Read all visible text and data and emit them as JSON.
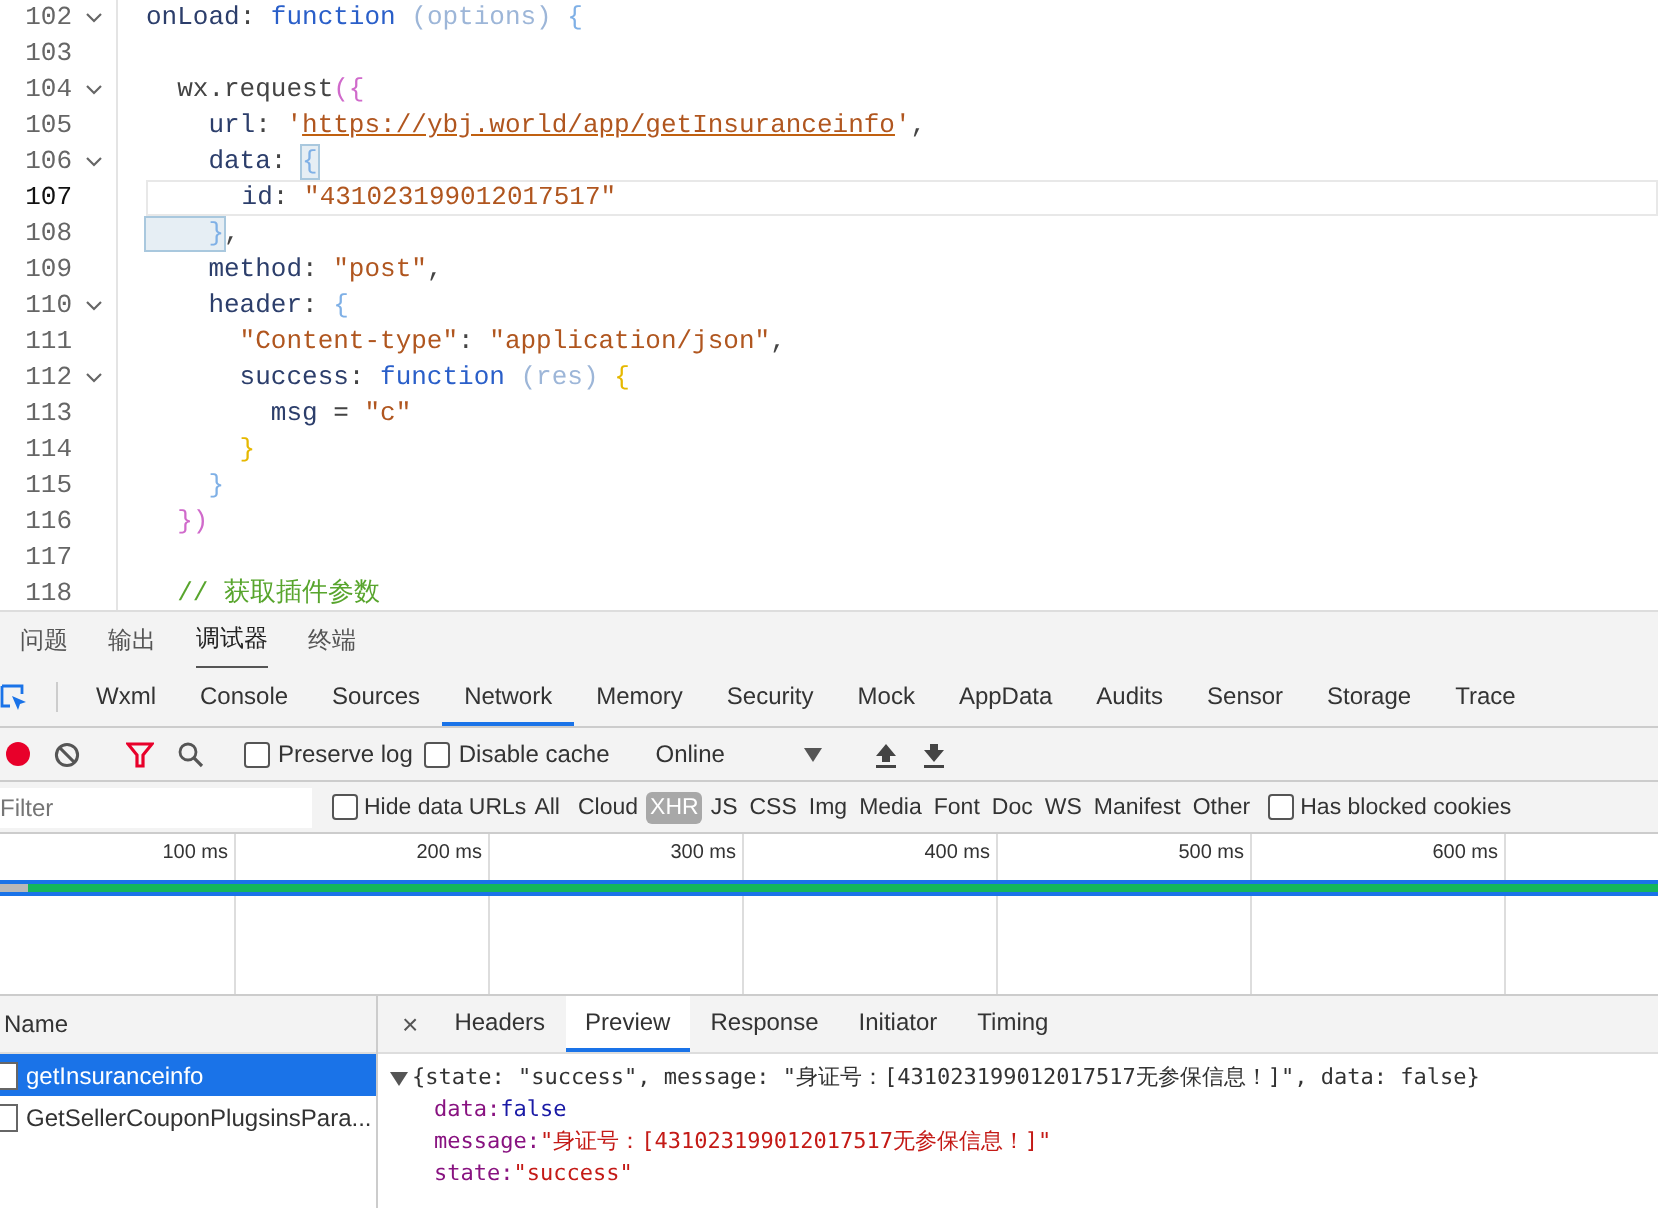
{
  "editor": {
    "lines": [
      {
        "number": "102",
        "foldable": true,
        "current": false,
        "tokens": [
          {
            "text": "onLoad",
            "kind": "key"
          },
          {
            "text": ": ",
            "kind": "plain"
          },
          {
            "text": "function ",
            "kind": "keyword"
          },
          {
            "text": "(options) ",
            "kind": "param"
          },
          {
            "text": "{",
            "kind": "brace"
          }
        ]
      },
      {
        "number": "103",
        "foldable": false,
        "current": false
      },
      {
        "number": "104",
        "foldable": true,
        "current": false,
        "tokens": [
          {
            "text": "  wx.request",
            "kind": "plain"
          },
          {
            "text": "({",
            "kind": "paren"
          }
        ]
      },
      {
        "number": "105",
        "foldable": false,
        "current": false,
        "tokens": [
          {
            "text": "    url",
            "kind": "key"
          },
          {
            "text": ": ",
            "kind": "plain"
          },
          {
            "text": "'",
            "kind": "string"
          },
          {
            "text": "https://ybj.world/app/getInsuranceinfo",
            "kind": "url"
          },
          {
            "text": "'",
            "kind": "string"
          },
          {
            "text": ",",
            "kind": "plain"
          }
        ]
      },
      {
        "number": "106",
        "foldable": true,
        "current": false,
        "tokens": [
          {
            "text": "    data",
            "kind": "key"
          },
          {
            "text": ": ",
            "kind": "plain"
          },
          {
            "text": "{",
            "kind": "match"
          }
        ]
      },
      {
        "number": "107",
        "foldable": false,
        "current": true,
        "tokens": [
          {
            "text": "      id",
            "kind": "key"
          },
          {
            "text": ": ",
            "kind": "plain"
          },
          {
            "text": "\"431023199012017517\"",
            "kind": "string"
          }
        ]
      },
      {
        "number": "108",
        "foldable": false,
        "current": false,
        "tokens": [
          {
            "text": "    }",
            "kind": "match"
          },
          {
            "text": ",",
            "kind": "plain"
          }
        ]
      },
      {
        "number": "109",
        "foldable": false,
        "current": false,
        "tokens": [
          {
            "text": "    method",
            "kind": "key"
          },
          {
            "text": ": ",
            "kind": "plain"
          },
          {
            "text": "\"post\"",
            "kind": "string"
          },
          {
            "text": ",",
            "kind": "plain"
          }
        ]
      },
      {
        "number": "110",
        "foldable": true,
        "current": false,
        "tokens": [
          {
            "text": "    header",
            "kind": "key"
          },
          {
            "text": ": ",
            "kind": "plain"
          },
          {
            "text": "{",
            "kind": "brace"
          }
        ]
      },
      {
        "number": "111",
        "foldable": false,
        "current": false,
        "tokens": [
          {
            "text": "      \"Content-type\"",
            "kind": "string"
          },
          {
            "text": ": ",
            "kind": "plain"
          },
          {
            "text": "\"application/json\"",
            "kind": "string"
          },
          {
            "text": ",",
            "kind": "plain"
          }
        ]
      },
      {
        "number": "112",
        "foldable": true,
        "current": false,
        "tokens": [
          {
            "text": "      success",
            "kind": "key"
          },
          {
            "text": ": ",
            "kind": "plain"
          },
          {
            "text": "function ",
            "kind": "keyword"
          },
          {
            "text": "(res) ",
            "kind": "param"
          },
          {
            "text": "{",
            "kind": "brace2"
          }
        ]
      },
      {
        "number": "113",
        "foldable": false,
        "current": false,
        "tokens": [
          {
            "text": "        msg",
            "kind": "key"
          },
          {
            "text": " = ",
            "kind": "plain"
          },
          {
            "text": "\"c\"",
            "kind": "string"
          }
        ]
      },
      {
        "number": "114",
        "foldable": false,
        "current": false,
        "tokens": [
          {
            "text": "      }",
            "kind": "brace2"
          }
        ]
      },
      {
        "number": "115",
        "foldable": false,
        "current": false,
        "tokens": [
          {
            "text": "    }",
            "kind": "brace"
          }
        ]
      },
      {
        "number": "116",
        "foldable": false,
        "current": false,
        "tokens": [
          {
            "text": "  })",
            "kind": "paren"
          }
        ]
      },
      {
        "number": "117",
        "foldable": false,
        "current": false
      },
      {
        "number": "118",
        "foldable": false,
        "current": false,
        "tokens": [
          {
            "text": "  // 获取插件参数",
            "kind": "comment"
          }
        ]
      }
    ]
  },
  "panel_tabs": [
    {
      "label": "问题",
      "selected": false
    },
    {
      "label": "输出",
      "selected": false
    },
    {
      "label": "调试器",
      "selected": true
    },
    {
      "label": "终端",
      "selected": false
    }
  ],
  "devtools_tabs": [
    {
      "label": "Wxml",
      "selected": false
    },
    {
      "label": "Console",
      "selected": false
    },
    {
      "label": "Sources",
      "selected": false
    },
    {
      "label": "Network",
      "selected": true
    },
    {
      "label": "Memory",
      "selected": false
    },
    {
      "label": "Security",
      "selected": false
    },
    {
      "label": "Mock",
      "selected": false
    },
    {
      "label": "AppData",
      "selected": false
    },
    {
      "label": "Audits",
      "selected": false
    },
    {
      "label": "Sensor",
      "selected": false
    },
    {
      "label": "Storage",
      "selected": false
    },
    {
      "label": "Trace",
      "selected": false
    }
  ],
  "toolbar": {
    "recording": true,
    "preserve_log": {
      "label": "Preserve log",
      "checked": false
    },
    "disable_cache": {
      "label": "Disable cache",
      "checked": false
    },
    "throttling": "Online"
  },
  "filter_bar": {
    "placeholder": "Filter",
    "hide_data_urls": {
      "label": "Hide data URLs",
      "checked": false
    },
    "types": [
      {
        "label": "All",
        "selected": false
      },
      {
        "label": "Cloud",
        "selected": false
      },
      {
        "label": "XHR",
        "selected": true
      },
      {
        "label": "JS",
        "selected": false
      },
      {
        "label": "CSS",
        "selected": false
      },
      {
        "label": "Img",
        "selected": false
      },
      {
        "label": "Media",
        "selected": false
      },
      {
        "label": "Font",
        "selected": false
      },
      {
        "label": "Doc",
        "selected": false
      },
      {
        "label": "WS",
        "selected": false
      },
      {
        "label": "Manifest",
        "selected": false
      },
      {
        "label": "Other",
        "selected": false
      }
    ],
    "blocked_cookies": {
      "label": "Has blocked cookies",
      "checked": false
    }
  },
  "timeline": {
    "ticks": [
      "100 ms",
      "200 ms",
      "300 ms",
      "400 ms",
      "500 ms",
      "600 ms"
    ]
  },
  "requests": {
    "header": "Name",
    "items": [
      {
        "name": "getInsuranceinfo",
        "selected": true
      },
      {
        "name": "GetSellerCouponPlugsinsPara...",
        "selected": false
      }
    ]
  },
  "detail": {
    "close": "×",
    "tabs": [
      {
        "label": "Headers",
        "selected": false
      },
      {
        "label": "Preview",
        "selected": true
      },
      {
        "label": "Response",
        "selected": false
      },
      {
        "label": "Initiator",
        "selected": false
      },
      {
        "label": "Timing",
        "selected": false
      }
    ],
    "preview": {
      "expanded": true,
      "summary": "{state: \"success\", message: \"身证号：[431023199012017517无参保信息！]\", data: false}",
      "properties": [
        {
          "key": "data:",
          "value": "false",
          "kind": "literal"
        },
        {
          "key": "message:",
          "value": "\"身证号：[431023199012017517无参保信息！]\"",
          "kind": "string"
        },
        {
          "key": "state:",
          "value": "\"success\"",
          "kind": "string"
        }
      ]
    }
  }
}
